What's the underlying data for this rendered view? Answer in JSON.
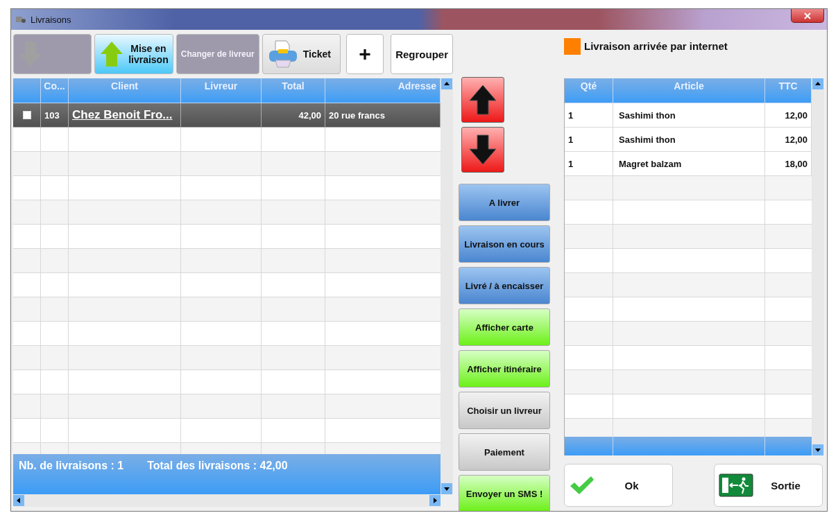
{
  "window": {
    "title": "Livraisons"
  },
  "toolbar": [
    {
      "kind": "down",
      "disabled": true
    },
    {
      "kind": "up",
      "label": "Mise en livraison",
      "disabled": false
    },
    {
      "kind": "text",
      "label": "Changer de livreur",
      "disabled": true
    },
    {
      "kind": "printer",
      "label": "Ticket",
      "disabled": false
    },
    {
      "kind": "plus",
      "label": "+",
      "disabled": false
    },
    {
      "kind": "white",
      "label": "Regrouper",
      "disabled": false
    }
  ],
  "deliveries": {
    "columns": [
      "Co...",
      "Client",
      "Livreur",
      "Total",
      "Adresse"
    ],
    "rows": [
      {
        "checked": false,
        "selected": true,
        "code": "103",
        "client": "Chez Benoit Fro...",
        "total": "42,00",
        "address": "20 rue francs"
      }
    ],
    "count": "Nb. de livraisons : 1",
    "sum": "Total des livraisons : 42,00"
  },
  "move_buttons": [
    {
      "kind": "up"
    },
    {
      "kind": "down"
    }
  ],
  "actions": [
    {
      "kind": "blue",
      "label": "A livrer"
    },
    {
      "kind": "blue",
      "label": "Livraison en cours"
    },
    {
      "kind": "blue",
      "label": "Livré / à encaisser"
    },
    {
      "kind": "green",
      "label": "Afficher carte"
    },
    {
      "kind": "green",
      "label": "Afficher itinéraire"
    },
    {
      "kind": "grey",
      "label": "Choisir un livreur"
    },
    {
      "kind": "grey",
      "label": "Paiement"
    },
    {
      "kind": "green",
      "label": "Envoyer un SMS !"
    }
  ],
  "legend": {
    "color": "#ff8000",
    "label": "Livraison arrivée par internet"
  },
  "items": {
    "columns": [
      "Qté",
      "Article",
      "TTC"
    ],
    "rows": [
      {
        "qty": "1",
        "article": "Sashimi thon",
        "price": "12,00"
      },
      {
        "qty": "1",
        "article": "Sashimi thon",
        "price": "12,00"
      },
      {
        "qty": "1",
        "article": "Magret balzam",
        "price": "18,00"
      }
    ]
  },
  "footer_buttons": [
    {
      "kind": "ok",
      "label": "Ok"
    },
    {
      "kind": "exit",
      "label": "Sortie"
    }
  ]
}
